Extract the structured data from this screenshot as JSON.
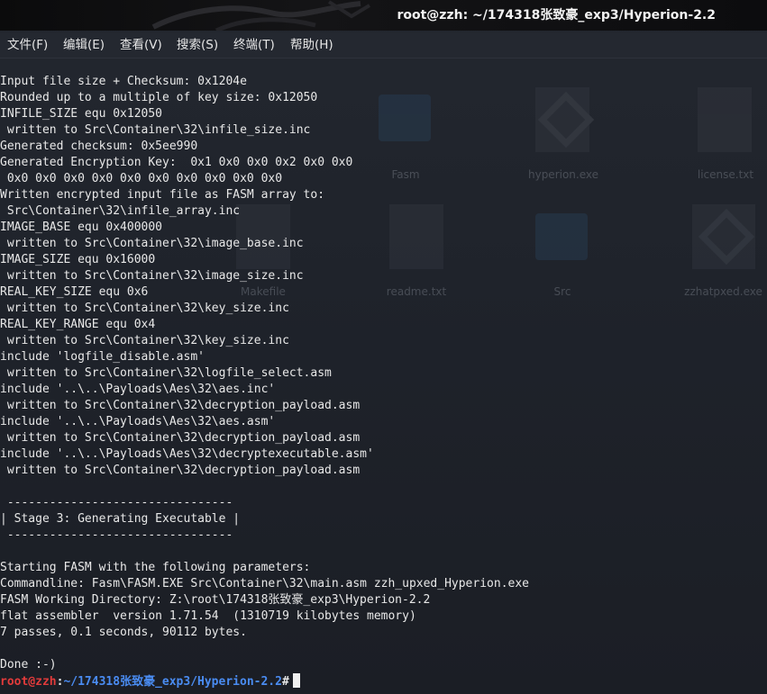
{
  "window": {
    "title": "root@zzh: ~/174318张致豪_exp3/Hyperion-2.2"
  },
  "menu": [
    {
      "label": "文件(F)"
    },
    {
      "label": "编辑(E)"
    },
    {
      "label": "查看(V)"
    },
    {
      "label": "搜索(S)"
    },
    {
      "label": "终端(T)"
    },
    {
      "label": "帮助(H)"
    }
  ],
  "desktop_icons": [
    {
      "label": "Fasm",
      "icon": "folder-icon"
    },
    {
      "label": "hyperion.exe",
      "icon": "exe-icon"
    },
    {
      "label": "license.txt",
      "icon": "text-file-icon"
    },
    {
      "label": "Makefile",
      "icon": "text-file-icon"
    },
    {
      "label": "readme.txt",
      "icon": "text-file-icon"
    },
    {
      "label": "Src",
      "icon": "folder-icon"
    },
    {
      "label": "zzhatpxed.exe",
      "icon": "exe-icon"
    }
  ],
  "terminal": {
    "lines": [
      "Input file size + Checksum: 0x1204e",
      "Rounded up to a multiple of key size: 0x12050",
      "INFILE_SIZE equ 0x12050",
      " written to Src\\Container\\32\\infile_size.inc",
      "Generated checksum: 0x5ee990",
      "Generated Encryption Key:  0x1 0x0 0x0 0x2 0x0 0x0",
      " 0x0 0x0 0x0 0x0 0x0 0x0 0x0 0x0 0x0 0x0",
      "Written encrypted input file as FASM array to:",
      " Src\\Container\\32\\infile_array.inc",
      "IMAGE_BASE equ 0x400000",
      " written to Src\\Container\\32\\image_base.inc",
      "IMAGE_SIZE equ 0x16000",
      " written to Src\\Container\\32\\image_size.inc",
      "REAL_KEY_SIZE equ 0x6",
      " written to Src\\Container\\32\\key_size.inc",
      "REAL_KEY_RANGE equ 0x4",
      " written to Src\\Container\\32\\key_size.inc",
      "include 'logfile_disable.asm'",
      " written to Src\\Container\\32\\logfile_select.asm",
      "include '..\\..\\Payloads\\Aes\\32\\aes.inc'",
      " written to Src\\Container\\32\\decryption_payload.asm",
      "include '..\\..\\Payloads\\Aes\\32\\aes.asm'",
      " written to Src\\Container\\32\\decryption_payload.asm",
      "include '..\\..\\Payloads\\Aes\\32\\decryptexecutable.asm'",
      " written to Src\\Container\\32\\decryption_payload.asm",
      "",
      " --------------------------------",
      "| Stage 3: Generating Executable |",
      " --------------------------------",
      "",
      "Starting FASM with the following parameters:",
      "Commandline: Fasm\\FASM.EXE Src\\Container\\32\\main.asm zzh_upxed_Hyperion.exe",
      "FASM Working Directory: Z:\\root\\174318张致豪_exp3\\Hyperion-2.2",
      "flat assembler  version 1.71.54  (1310719 kilobytes memory)",
      "7 passes, 0.1 seconds, 90112 bytes.",
      "",
      "Done :-)"
    ],
    "prompt": {
      "user_host": "root@zzh",
      "colon": ":",
      "path": "~/174318张致豪_exp3/Hyperion-2.2",
      "symbol": "#"
    }
  }
}
